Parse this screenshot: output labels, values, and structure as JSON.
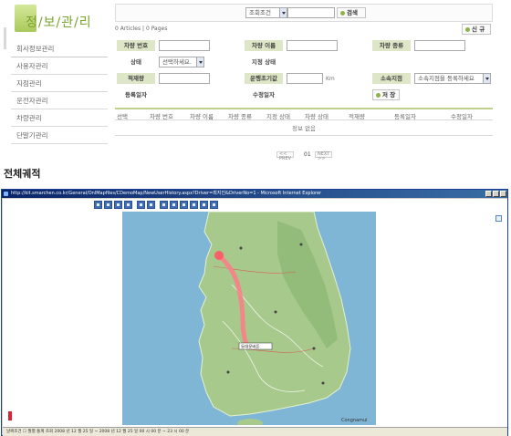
{
  "sidebar": {
    "title": "정/보/관/리",
    "items": [
      {
        "label": "회사정보관리"
      },
      {
        "label": "사용자관리"
      },
      {
        "label": "지점관리"
      },
      {
        "label": "운전자관리"
      },
      {
        "label": "차량관리"
      },
      {
        "label": "단말기관리"
      }
    ]
  },
  "search": {
    "condition_select": "조회조건",
    "search_button": "검색"
  },
  "list_meta": {
    "articles": "0 Articles",
    "pages": "0 Pages",
    "new_button": "신 규"
  },
  "form": {
    "vehicle_no_label": "차량 번호",
    "vehicle_name_label": "차량 이름",
    "vehicle_type_label": "차량 종류",
    "status_label": "상태",
    "status_value": "선택하세요.",
    "designated_status_label": "지정 상태",
    "payload_label": "적재량",
    "odometer_label": "운행초기값",
    "odometer_unit": "Km",
    "branch_label": "소속지점",
    "branch_value": "소속지점을 등록하세요",
    "reg_date_label": "등록일자",
    "mod_date_label": "수정일자",
    "save_button": "저 장"
  },
  "table": {
    "headers": [
      "선택",
      "차량 번호",
      "차량 이름",
      "차량 종류",
      "지정 상태",
      "차량 상태",
      "적재량",
      "등록일자",
      "수정일자"
    ],
    "empty_text": "정보 없음"
  },
  "pager": {
    "prev": "PREV",
    "current": "01",
    "next": "NEXT"
  },
  "section_title": "전체궤적",
  "ie_window": {
    "title": "http://kit.smarchen.co.kr/General/OnlMapfiles/CDemoMap/NewUserHistory.aspx?Driver=최지진&DriverNo=1 - Microsoft Internet Explorer",
    "map_brand": "Congnamul",
    "map_label": "동대문버튼",
    "status_text": "날짜조건 ☐ 월별 통계 조회 2008 년 12 월 25 일 ~ 2008 년 12 월 25 일 00 시 00 분 ~ 23 시 00 분"
  },
  "colors": {
    "accent": "#8db24a",
    "label_bg": "#dde7c7",
    "title_bar": "#0a246a",
    "sea": "#7fb6d6",
    "land": "#a7c98c",
    "route": "#ff6b6b"
  }
}
